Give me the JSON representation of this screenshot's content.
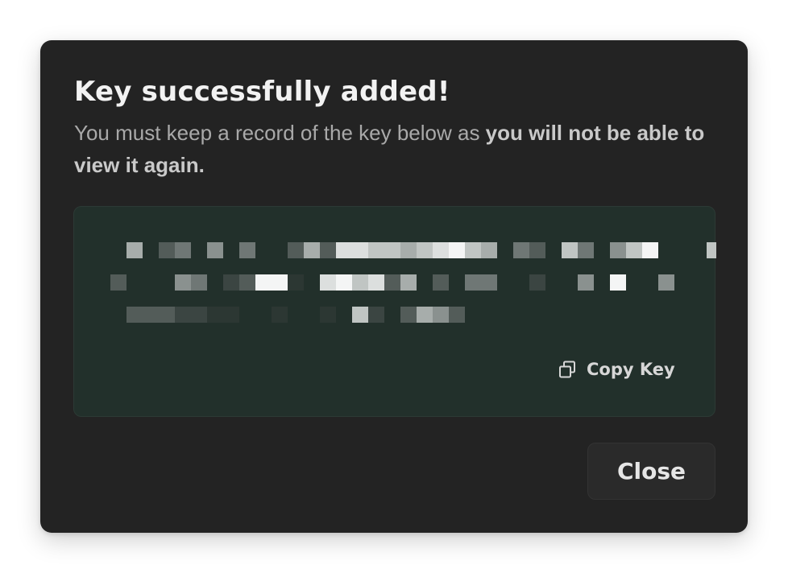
{
  "dialog": {
    "title": "Key successfully added!",
    "description_plain": "You must keep a record of the key below as ",
    "description_bold": "you will not be able to view it again.",
    "key_redacted": true,
    "copy_key_label": "Copy Key",
    "copy_icon": "copy-icon",
    "close_label": "Close"
  },
  "colors": {
    "dialog_background": "#232323",
    "key_box_background": "#22302b",
    "title_text": "#f2f2f2",
    "body_text": "#a9a9a9"
  }
}
